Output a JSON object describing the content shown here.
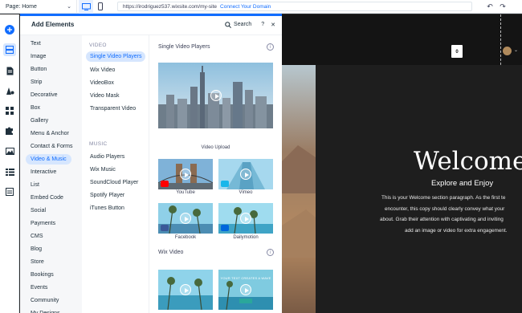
{
  "topbar": {
    "page_label": "Page: Home",
    "url": "https://irodriguez537.wixsite.com/my-site",
    "connect_domain": "Connect Your Domain"
  },
  "rail": {
    "items": [
      "add-icon",
      "sections-icon",
      "pages-icon",
      "design-icon",
      "apps-icon",
      "business-icon",
      "media-icon",
      "cms-icon",
      "content-icon"
    ]
  },
  "panel": {
    "title": "Add Elements",
    "search_label": "Search",
    "help": "?",
    "close": "✕",
    "categories": [
      "Text",
      "Image",
      "Button",
      "Strip",
      "Decorative",
      "Box",
      "Gallery",
      "Menu & Anchor",
      "Contact & Forms",
      "Video & Music",
      "Interactive",
      "List",
      "Embed Code",
      "Social",
      "Payments",
      "CMS",
      "Blog",
      "Store",
      "Bookings",
      "Events",
      "Community",
      "My Designs"
    ],
    "active_category": "Video & Music",
    "video_heading": "VIDEO",
    "video_items": [
      "Single Video Players",
      "Wix Video",
      "VideoBox",
      "Video Mask",
      "Transparent Video"
    ],
    "music_heading": "MUSIC",
    "music_items": [
      "Audio Players",
      "Wix Music",
      "SoundCloud Player",
      "Spotify Player",
      "iTunes Button"
    ],
    "section1_title": "Single Video Players",
    "section2_title": "Wix Video",
    "info": "i",
    "captions": {
      "upload": "Video Upload",
      "youtube": "YouTube",
      "vimeo": "Vimeo",
      "facebook": "Facebook",
      "dailymotion": "Dailymotion"
    },
    "thumb_caption_small": "YOUR TEXT CREATES A WAVE"
  },
  "site": {
    "cart_count": "0",
    "welcome": "Welcome",
    "explore": "Explore and Enjoy",
    "paragraph": [
      "This is your Welcome section paragraph. As the first te",
      "encounter, this copy should clearly convey what your",
      "about. Grab their attention with captivating and inviting",
      "add an image or video for extra engagement."
    ]
  },
  "colors": {
    "accent": "#116dff",
    "accent_light": "#d6e6fe",
    "youtube": "#ff0000",
    "vimeo": "#1ab7ea",
    "facebook": "#3b5998",
    "dailymotion": "#0066dc"
  }
}
